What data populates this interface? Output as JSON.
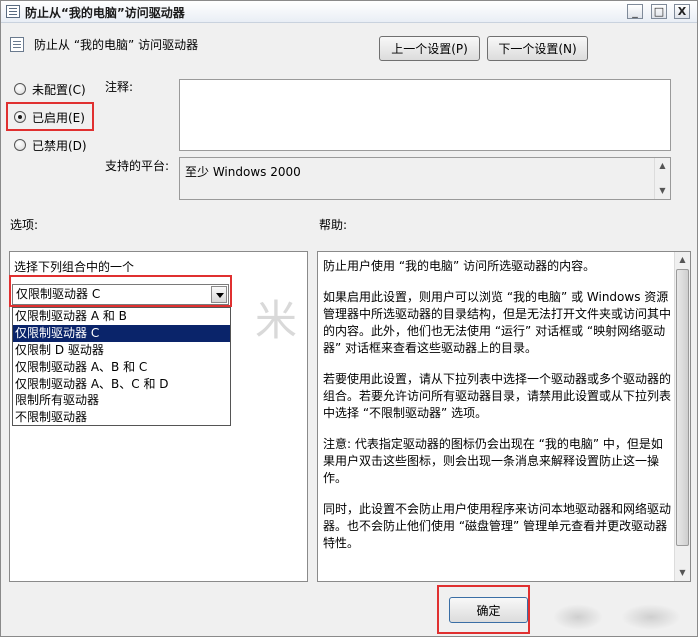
{
  "window": {
    "title": "防止从“我的电脑”访问驱动器",
    "minimize_glyph": "_",
    "maximize_glyph": "□",
    "close_glyph": "X"
  },
  "header": {
    "policy_title": "防止从 “我的电脑” 访问驱动器",
    "prev_button": "上一个设置(P)",
    "next_button": "下一个设置(N)"
  },
  "state": {
    "options": [
      {
        "label": "未配置(C)",
        "checked": false
      },
      {
        "label": "已启用(E)",
        "checked": true
      },
      {
        "label": "已禁用(D)",
        "checked": false
      }
    ]
  },
  "comment": {
    "label": "注释:",
    "value": ""
  },
  "platform": {
    "label": "支持的平台:",
    "value": "至少 Windows 2000"
  },
  "options_panel": {
    "heading": "选项:",
    "combo_label": "选择下列组合中的一个",
    "selected_value": "仅限制驱动器 C",
    "items": [
      "仅限制驱动器 A 和 B",
      "仅限制驱动器 C",
      "仅限制 D 驱动器",
      "仅限制驱动器 A、B 和 C",
      "仅限制驱动器 A、B、C 和 D",
      "限制所有驱动器",
      "不限制驱动器"
    ],
    "selected_index": 1
  },
  "help_panel": {
    "heading": "帮助:",
    "paragraphs": [
      "防止用户使用 “我的电脑” 访问所选驱动器的内容。",
      "如果启用此设置，则用户可以浏览 “我的电脑” 或 Windows 资源管理器中所选驱动器的目录结构，但是无法打开文件夹或访问其中的内容。此外，他们也无法使用 “运行” 对话框或 “映射网络驱动器” 对话框来查看这些驱动器上的目录。",
      "若要使用此设置，请从下拉列表中选择一个驱动器或多个驱动器的组合。若要允许访问所有驱动器目录，请禁用此设置或从下拉列表中选择 “不限制驱动器” 选项。",
      "注意: 代表指定驱动器的图标仍会出现在 “我的电脑” 中，但是如果用户双击这些图标，则会出现一条消息来解释设置防止这一操作。",
      "同时，此设置不会防止用户使用程序来访问本地驱动器和网络驱动器。也不会防止他们使用 “磁盘管理” 管理单元查看并更改驱动器特性。"
    ]
  },
  "footer": {
    "ok_button": "确定"
  },
  "watermark": "米"
}
